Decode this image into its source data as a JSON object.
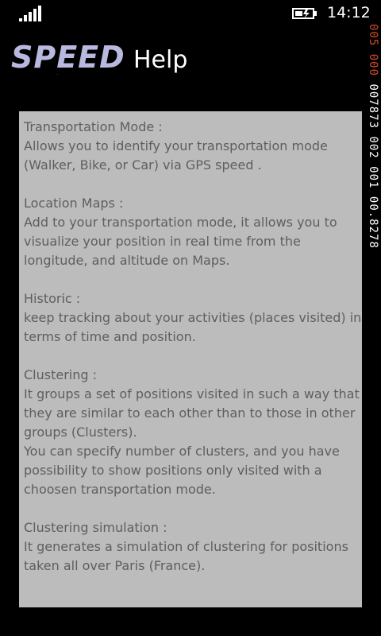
{
  "status_bar": {
    "time": "14:12",
    "signal_icon": "signal-bars-icon",
    "battery_icon": "battery-charging-icon"
  },
  "header": {
    "logo_text": "SPEED",
    "logo_subtext": "...",
    "title": "Help"
  },
  "debug_overlay": {
    "line1": "005 000",
    "line2": "007873 002 001 00.8278",
    "colors": {
      "line1": "#d24a2a",
      "line2": "#ffffff"
    }
  },
  "help": {
    "sections": [
      {
        "lines": [
          "Transportation Mode :",
          "Allows you to identify your transportation mode",
          "(Walker, Bike, or Car) via GPS speed ."
        ]
      },
      {
        "lines": [
          "Location Maps :",
          "Add to your transportation mode, it allows you to",
          "visualize your position in real time from the",
          "longitude, and altitude on Maps."
        ]
      },
      {
        "lines": [
          "Historic :",
          "keep tracking about your activities (places visited) in",
          "terms of time and position."
        ]
      },
      {
        "lines": [
          "Clustering :",
          "It groups a set of positions visited in such a way that",
          "they are similar to each other than to those in other",
          "groups (Clusters).",
          "You can specify number of clusters, and you have",
          "possibility to show positions only visited with a",
          "choosen transportation mode."
        ]
      },
      {
        "lines": [
          "Clustering simulation :",
          "It generates a simulation  of clustering for positions",
          "taken all over Paris (France)."
        ]
      }
    ]
  },
  "colors": {
    "background": "#000000",
    "panel": "#bcbcbc",
    "panel_text": "#5e5e5e",
    "logo": "#b9b9e0"
  }
}
